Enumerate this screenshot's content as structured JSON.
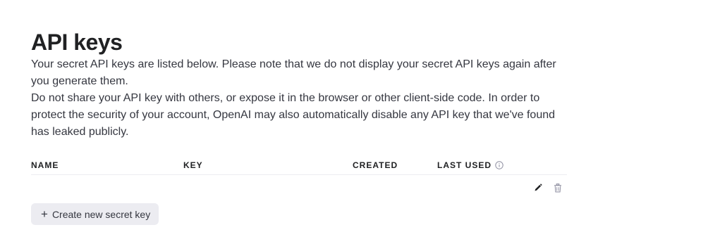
{
  "page": {
    "title": "API keys",
    "description_1": "Your secret API keys are listed below. Please note that we do not display your secret API keys again after you generate them.",
    "description_2": "Do not share your API key with others, or expose it in the browser or other client-side code. In order to protect the security of your account, OpenAI may also automatically disable any API key that we've found has leaked publicly."
  },
  "table": {
    "columns": [
      "NAME",
      "KEY",
      "CREATED",
      "LAST USED"
    ],
    "rows": [
      {
        "name": "",
        "key": "",
        "created": "",
        "last_used": "",
        "actions": [
          "edit-icon",
          "trash-icon"
        ]
      }
    ]
  },
  "icons": {
    "last_used_info": "info-icon",
    "create_button": "plus-icon"
  },
  "create_button": {
    "icon": "+",
    "label": "Create new secret key"
  },
  "colors": {
    "text": "#202123",
    "secondary_text": "#353740",
    "button_bg": "#ececf1",
    "divider": "#ececf1",
    "delete_icon": "#8e8ea0"
  }
}
